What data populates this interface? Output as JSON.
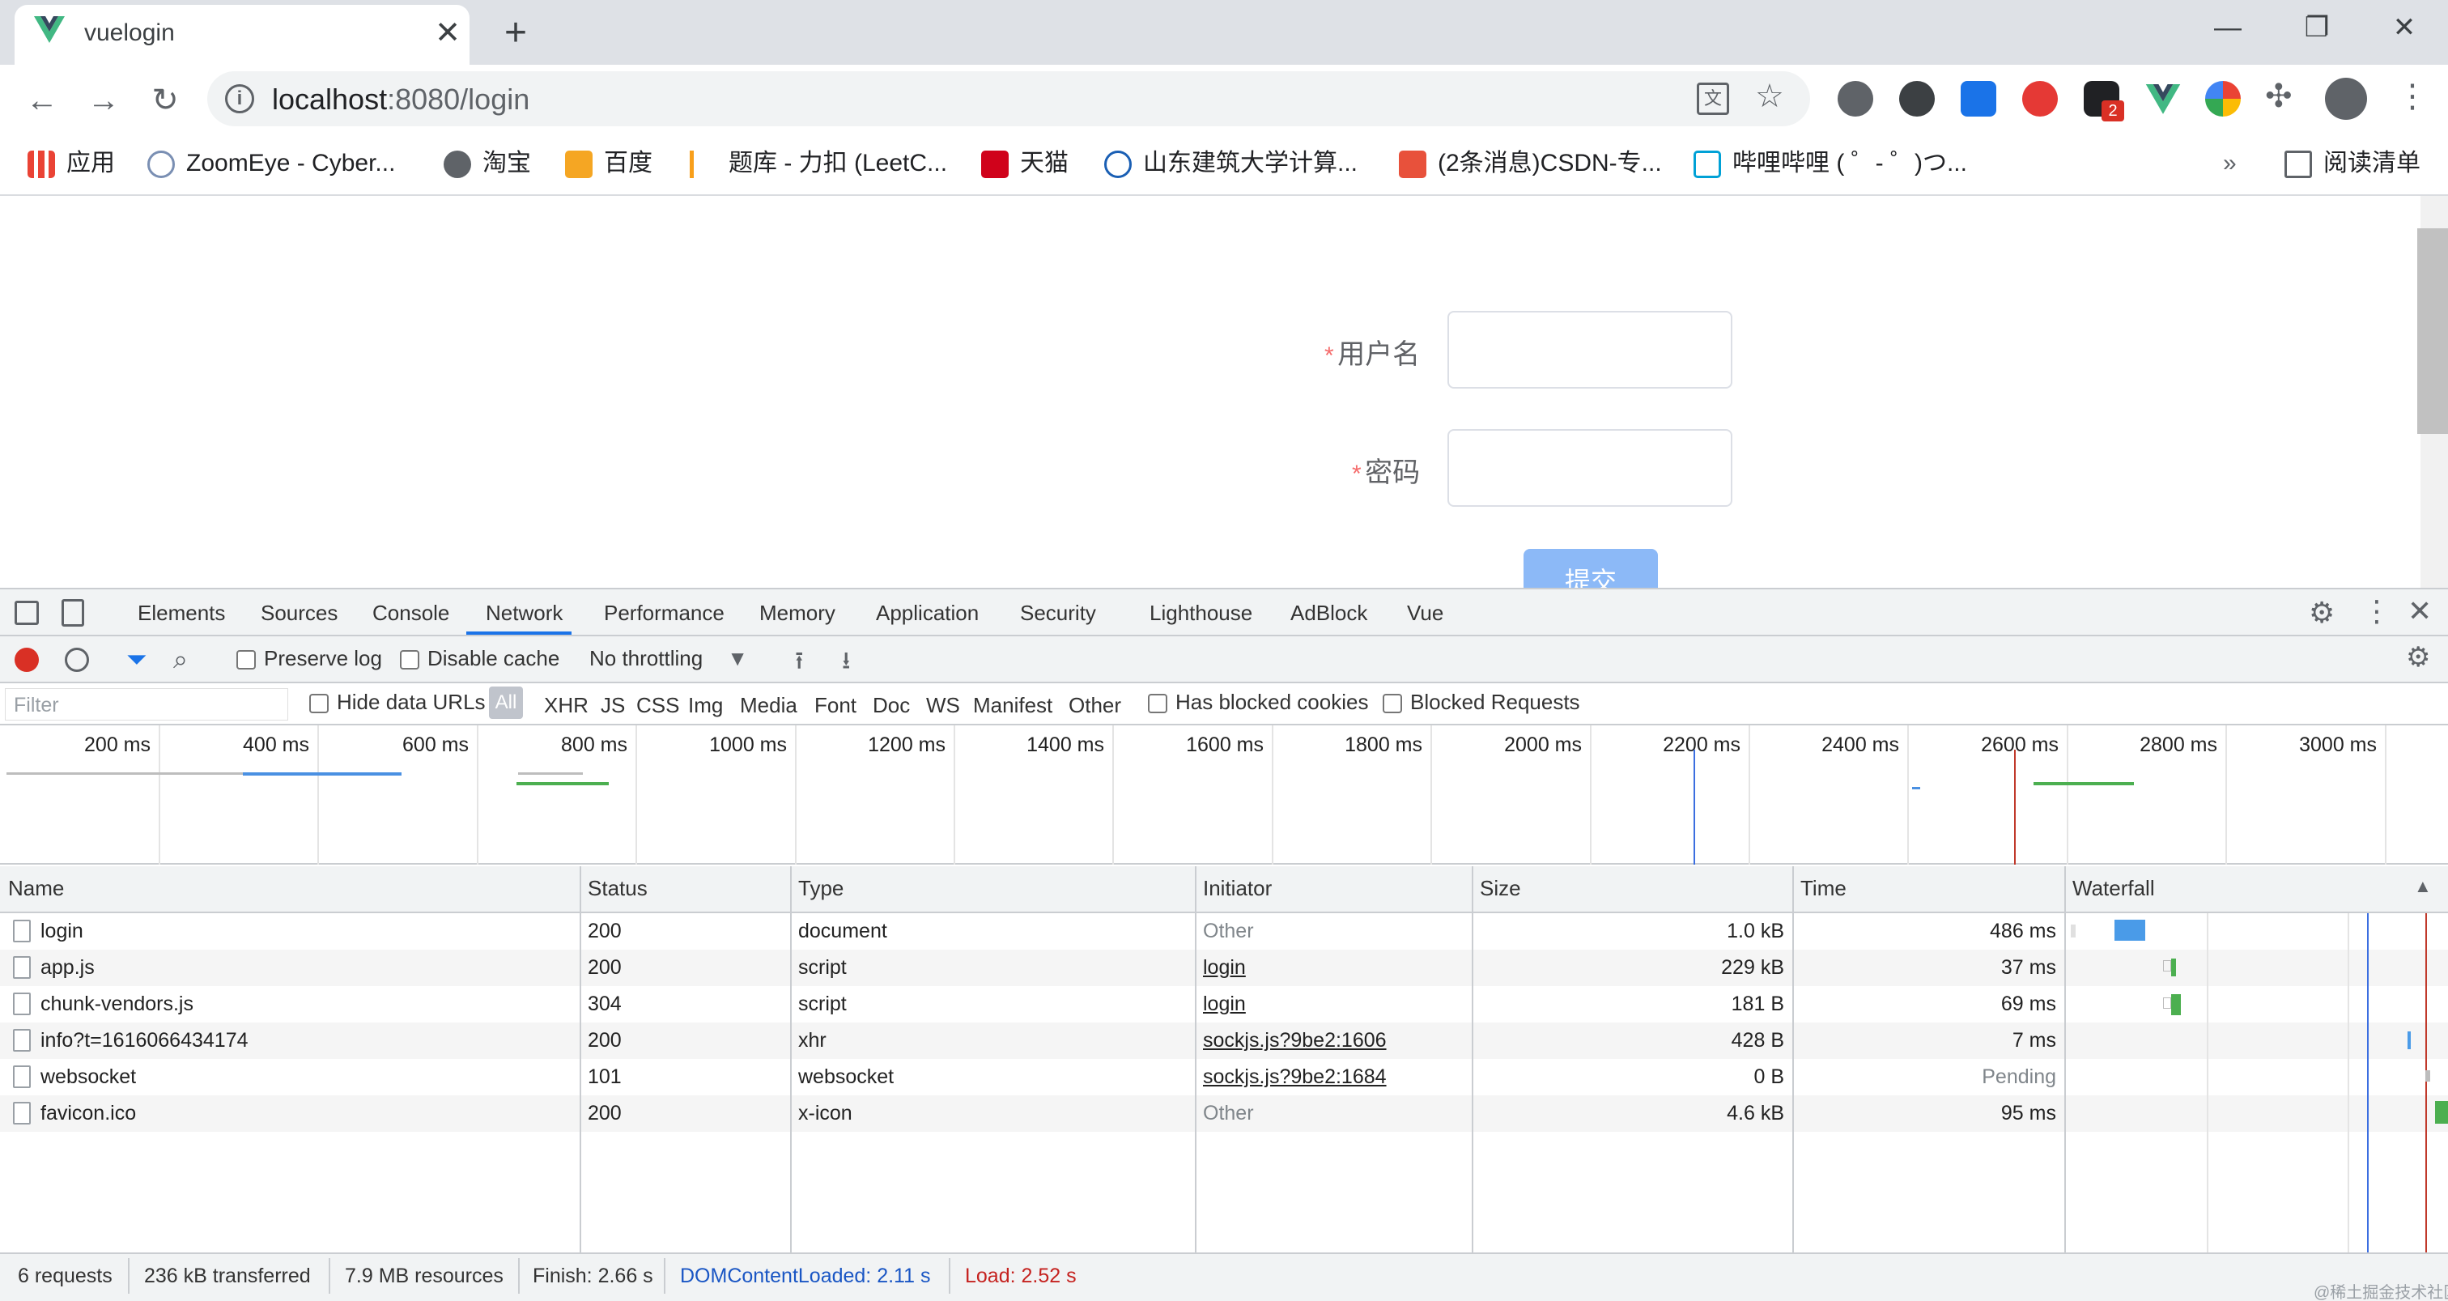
{
  "browser": {
    "tab_title": "vuelogin",
    "tab_close": "✕",
    "new_tab": "+",
    "window_controls": {
      "minimize": "—",
      "restore": "❐",
      "close": "✕"
    },
    "url_host": "localhost",
    "url_path": ":8080/login",
    "bookmarks": [
      {
        "label": "应用",
        "icon": "apps-grid-icon"
      },
      {
        "label": "ZoomEye - Cyber...",
        "icon": "zoomeye-icon"
      },
      {
        "label": "淘宝",
        "icon": "globe-icon"
      },
      {
        "label": "百度",
        "icon": "baidu-icon"
      },
      {
        "label": "题库 - 力扣 (LeetC...",
        "icon": "leetcode-icon"
      },
      {
        "label": "天猫",
        "icon": "tmall-icon"
      },
      {
        "label": "山东建筑大学计算...",
        "icon": "cg-icon"
      },
      {
        "label": "(2条消息)CSDN-专...",
        "icon": "csdn-icon"
      },
      {
        "label": "哔哩哔哩 ( ゜- ゜)つ...",
        "icon": "bilibili-icon"
      }
    ],
    "bookmarks_more": "»",
    "reading_list": "阅读清单",
    "extension_badge": "2"
  },
  "page": {
    "username_label": "用户名",
    "password_label": "密码",
    "required_mark": "*",
    "submit_label": "提交"
  },
  "devtools": {
    "tabs": [
      "Elements",
      "Sources",
      "Console",
      "Network",
      "Performance",
      "Memory",
      "Application",
      "Security",
      "Lighthouse",
      "AdBlock",
      "Vue"
    ],
    "active_tab": "Network",
    "toolbar": {
      "preserve_log": "Preserve log",
      "disable_cache": "Disable cache",
      "throttling": "No throttling"
    },
    "filter": {
      "placeholder": "Filter",
      "hide_data_urls": "Hide data URLs",
      "types": [
        "All",
        "XHR",
        "JS",
        "CSS",
        "Img",
        "Media",
        "Font",
        "Doc",
        "WS",
        "Manifest",
        "Other"
      ],
      "has_blocked_cookies": "Has blocked cookies",
      "blocked_requests": "Blocked Requests"
    },
    "overview_ticks": [
      "200 ms",
      "400 ms",
      "600 ms",
      "800 ms",
      "1000 ms",
      "1200 ms",
      "1400 ms",
      "1600 ms",
      "1800 ms",
      "2000 ms",
      "2200 ms",
      "2400 ms",
      "2600 ms",
      "2800 ms",
      "3000 ms"
    ],
    "columns": [
      "Name",
      "Status",
      "Type",
      "Initiator",
      "Size",
      "Time",
      "Waterfall"
    ],
    "sort_indicator": "▲",
    "rows": [
      {
        "name": "login",
        "status": "200",
        "type": "document",
        "initiator": "Other",
        "size": "1.0 kB",
        "time": "486 ms"
      },
      {
        "name": "app.js",
        "status": "200",
        "type": "script",
        "initiator": "login",
        "size": "229 kB",
        "time": "37 ms"
      },
      {
        "name": "chunk-vendors.js",
        "status": "304",
        "type": "script",
        "initiator": "login",
        "size": "181 B",
        "time": "69 ms"
      },
      {
        "name": "info?t=1616066434174",
        "status": "200",
        "type": "xhr",
        "initiator": "sockjs.js?9be2:1606",
        "size": "428 B",
        "time": "7 ms"
      },
      {
        "name": "websocket",
        "status": "101",
        "type": "websocket",
        "initiator": "sockjs.js?9be2:1684",
        "size": "0 B",
        "time": "Pending"
      },
      {
        "name": "favicon.ico",
        "status": "200",
        "type": "x-icon",
        "initiator": "Other",
        "size": "4.6 kB",
        "time": "95 ms"
      }
    ],
    "status_bar": {
      "requests": "6 requests",
      "transferred": "236 kB transferred",
      "resources": "7.9 MB resources",
      "finish": "Finish: 2.66 s",
      "dom_content_loaded": "DOMContentLoaded: 2.11 s",
      "load": "Load: 2.52 s"
    }
  },
  "colors": {
    "dcl_line": "#3b6ee0",
    "load_line": "#c0392b",
    "required": "#f56c6c",
    "submit_bg": "#8cb9f7",
    "record": "#d93025",
    "active_tab": "#1a73e8"
  },
  "watermark": "@稀土掘金技术社区"
}
